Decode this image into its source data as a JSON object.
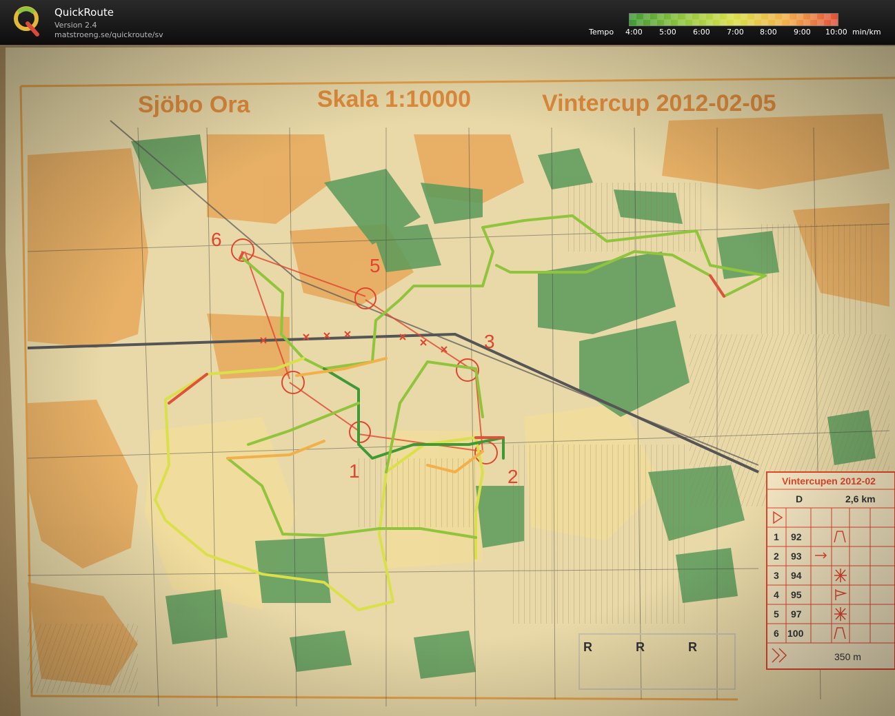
{
  "app": {
    "title": "QuickRoute",
    "version": "Version 2.4",
    "url": "matstroeng.se/quickroute/sv"
  },
  "legend": {
    "label": "Tempo",
    "ticks": [
      "4:00",
      "5:00",
      "6:00",
      "7:00",
      "8:00",
      "9:00",
      "10:00"
    ],
    "unit": "min/km",
    "colors": [
      "#3f9a36",
      "#8fc43c",
      "#d9e04a",
      "#f2b04a",
      "#e0503a"
    ]
  },
  "map": {
    "title": "Sjöbo Ora",
    "scale": "Skala 1:10000",
    "event": "Vintercup 2012-02-05",
    "control_labels": [
      "1",
      "2",
      "3",
      "5",
      "6"
    ],
    "table": {
      "header": "Vintercupen 2012-02",
      "class": "D",
      "length": "2,6 km",
      "rows": [
        {
          "num": "1",
          "code": "92"
        },
        {
          "num": "2",
          "code": "93"
        },
        {
          "num": "3",
          "code": "94"
        },
        {
          "num": "4",
          "code": "95"
        },
        {
          "num": "5",
          "code": "97"
        },
        {
          "num": "6",
          "code": "100"
        }
      ],
      "finish": "350 m"
    },
    "r_boxes": [
      "R",
      "R",
      "R"
    ]
  }
}
